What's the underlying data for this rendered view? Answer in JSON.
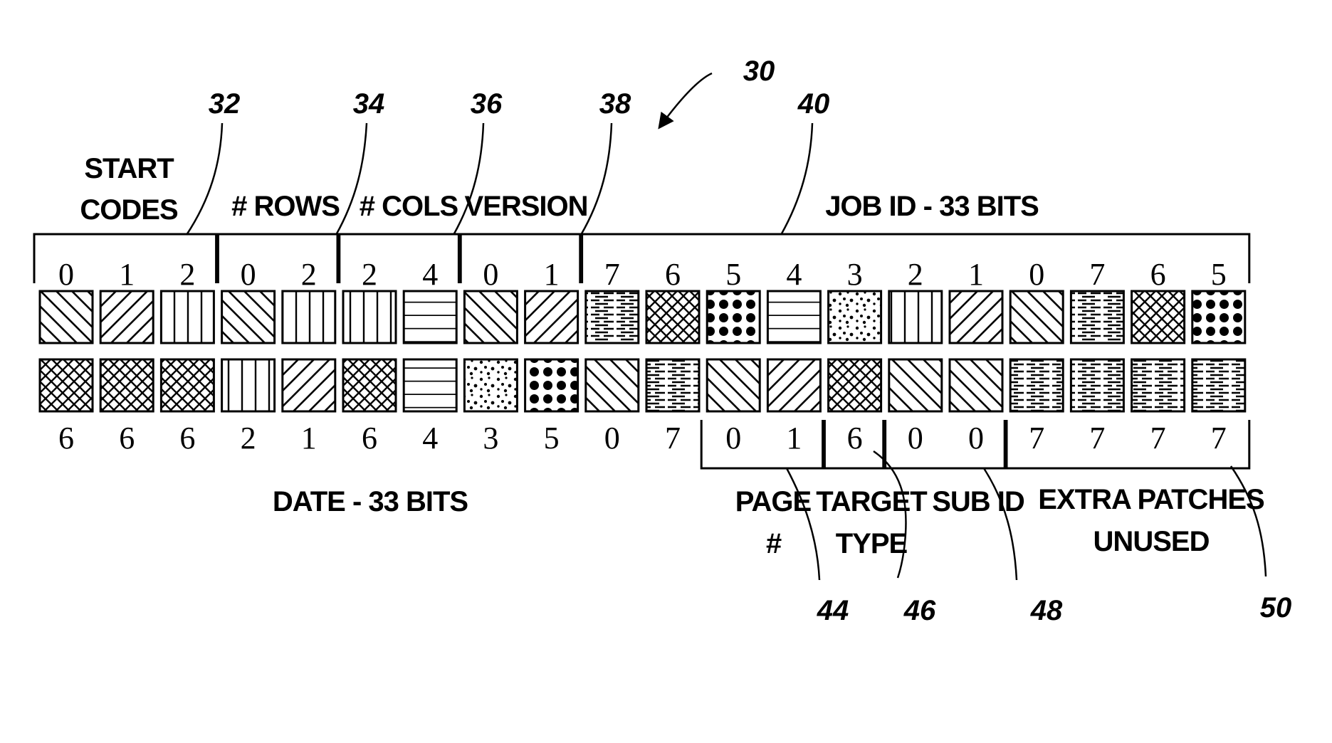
{
  "figure_ref": "30",
  "pattern_legend": {
    "0": "diagonal-backslash",
    "1": "diagonal-slash",
    "2": "vertical-lines",
    "3": "small-dots",
    "4": "horizontal-lines",
    "5": "large-dots",
    "6": "cross-hatch",
    "7": "dashed-horizontal"
  },
  "top_row_values": [
    0,
    1,
    2,
    0,
    2,
    2,
    4,
    0,
    1,
    7,
    6,
    5,
    4,
    3,
    2,
    1,
    0,
    7,
    6,
    5
  ],
  "bottom_row_values": [
    6,
    6,
    6,
    2,
    1,
    6,
    4,
    3,
    5,
    0,
    7,
    0,
    1,
    6,
    0,
    0,
    7,
    7,
    7,
    7
  ],
  "top_groups": [
    {
      "label": [
        "START",
        "CODES"
      ],
      "ref": "32",
      "start": 0,
      "end": 2
    },
    {
      "label": [
        "# ROWS"
      ],
      "ref": "34",
      "start": 3,
      "end": 4
    },
    {
      "label": [
        "# COLS"
      ],
      "ref": "36",
      "start": 5,
      "end": 6
    },
    {
      "label": [
        "VERSION"
      ],
      "ref": "38",
      "start": 7,
      "end": 8
    },
    {
      "label": [
        "JOB ID - 33 BITS"
      ],
      "ref": "40",
      "start": 9,
      "end": 19
    }
  ],
  "bottom_groups": [
    {
      "label": [
        "DATE - 33 BITS"
      ],
      "ref": "",
      "start": 0,
      "end": 10
    },
    {
      "label": [
        "PAGE",
        "#"
      ],
      "ref": "44",
      "start": 11,
      "end": 12
    },
    {
      "label": [
        "TARGET",
        "TYPE"
      ],
      "ref": "46",
      "start": 13,
      "end": 13
    },
    {
      "label": [
        "SUB ID"
      ],
      "ref": "48",
      "start": 14,
      "end": 15
    },
    {
      "label": [
        "EXTRA PATCHES",
        "UNUSED"
      ],
      "ref": "50",
      "start": 16,
      "end": 19
    }
  ]
}
